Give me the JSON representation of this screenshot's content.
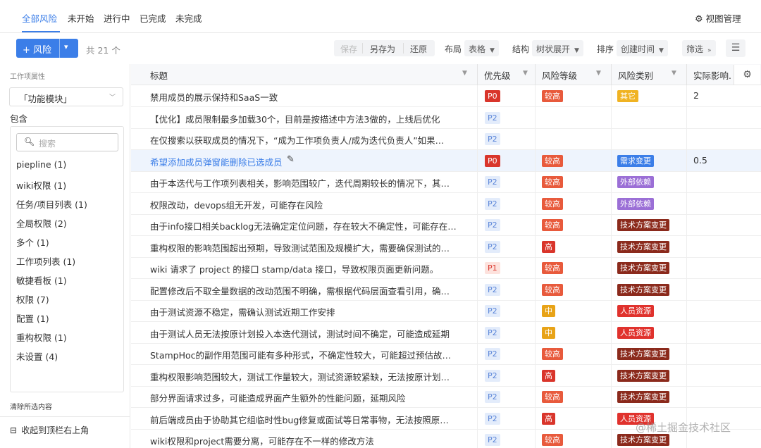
{
  "tabs": [
    "全部风险",
    "未开始",
    "进行中",
    "已完成",
    "未完成"
  ],
  "view_manager": "视图管理",
  "toolbar": {
    "add_label": "+ 风险",
    "count": "共 21 个",
    "save": "保存",
    "save_as": "另存为",
    "restore": "还原",
    "layout_label": "布局",
    "layout_value": "表格",
    "structure_label": "结构",
    "structure_value": "树状展开",
    "sort_label": "排序",
    "sort_value": "创建时间",
    "filter": "筛选"
  },
  "sidebar": {
    "attr_label": "工作项属性",
    "field_select": "「功能模块」",
    "include_label": "包含",
    "search_placeholder": "搜索",
    "items": [
      "piepline (1)",
      "wiki权限 (1)",
      "任务/项目列表 (1)",
      "全局权限 (2)",
      "多个 (1)",
      "工作项列表 (1)",
      "敏捷看板 (1)",
      "权限 (7)",
      "配置 (1)",
      "重构权限 (1)",
      "未设置 (4)"
    ],
    "clear": "清除所选内容",
    "collapse": "收起到顶栏右上角"
  },
  "table": {
    "headers": [
      "标题",
      "优先级",
      "风险等级",
      "风险类别",
      "实际影响."
    ],
    "rows": [
      {
        "title": "禁用成员的展示保持和SaaS一致",
        "priority": "P0",
        "level": "较高",
        "category": "其它",
        "impact": "2"
      },
      {
        "title": "【优化】成员限制最多加载30个，目前是按描述中方法3做的，上线后优化",
        "priority": "P2",
        "level": "",
        "category": "",
        "impact": ""
      },
      {
        "title": "在仅搜索以获取成员的情况下，“成为工作项负责人/成为迭代负责人”如果…",
        "priority": "P2",
        "level": "",
        "category": "",
        "impact": ""
      },
      {
        "title": "希望添加成员弹窗能删除已选成员",
        "priority": "P0",
        "level": "较高",
        "category": "需求变更",
        "impact": "0.5"
      },
      {
        "title": "由于本迭代与工作项列表相关，影响范围较广，迭代周期较长的情况下，其…",
        "priority": "P2",
        "level": "较高",
        "category": "外部依赖",
        "impact": ""
      },
      {
        "title": "权限改动，devops组无开发，可能存在风险",
        "priority": "P2",
        "level": "较高",
        "category": "外部依赖",
        "impact": ""
      },
      {
        "title": "由于info接口相关backlog无法确定定位问题，存在较大不确定性，可能存在…",
        "priority": "P2",
        "level": "较高",
        "category": "技术方案变更",
        "impact": ""
      },
      {
        "title": "重构权限的影响范围超出预期，导致测试范围及规模扩大，需要确保测试的…",
        "priority": "P2",
        "level": "高",
        "category": "技术方案变更",
        "impact": ""
      },
      {
        "title": "wiki 请求了 project 的接口 stamp/data 接口，导致权限页面更新问题。",
        "priority": "P1",
        "level": "较高",
        "category": "技术方案变更",
        "impact": ""
      },
      {
        "title": "配置修改后不取全量数据的改动范围不明确，需根据代码层面查看引用，确…",
        "priority": "P2",
        "level": "较高",
        "category": "技术方案变更",
        "impact": ""
      },
      {
        "title": "由于测试资源不稳定，需确认测试近期工作安排",
        "priority": "P2",
        "level": "中",
        "category": "人员资源",
        "impact": ""
      },
      {
        "title": "由于测试人员无法按原计划投入本迭代测试，测试时间不确定，可能造成延期",
        "priority": "P2",
        "level": "中",
        "category": "人员资源",
        "impact": ""
      },
      {
        "title": "StampHoc的副作用范围可能有多种形式，不确定性较大，可能超过预估故…",
        "priority": "P2",
        "level": "较高",
        "category": "技术方案变更",
        "impact": ""
      },
      {
        "title": "重构权限影响范围较大，测试工作量较大，测试资源较紧缺，无法按原计划…",
        "priority": "P2",
        "level": "高",
        "category": "技术方案变更",
        "impact": ""
      },
      {
        "title": "部分界面请求过多，可能造成界面产生额外的性能问题，延期风险",
        "priority": "P2",
        "level": "较高",
        "category": "技术方案变更",
        "impact": ""
      },
      {
        "title": "前后端成员由于协助其它组临时性bug修复或面试等日常事物，无法按照原…",
        "priority": "P2",
        "level": "高",
        "category": "人员资源",
        "impact": ""
      },
      {
        "title": "wiki权限和project需要分离，可能存在不一样的修改方法",
        "priority": "P2",
        "level": "较高",
        "category": "技术方案变更",
        "impact": ""
      }
    ]
  },
  "watermark": "@稀土掘金技术社区",
  "icons": {
    "add": "plus-icon",
    "view": "gear-icon",
    "list": "list-icon",
    "search": "search-icon",
    "edit": "pencil-icon",
    "collapse": "collapse-icon"
  }
}
